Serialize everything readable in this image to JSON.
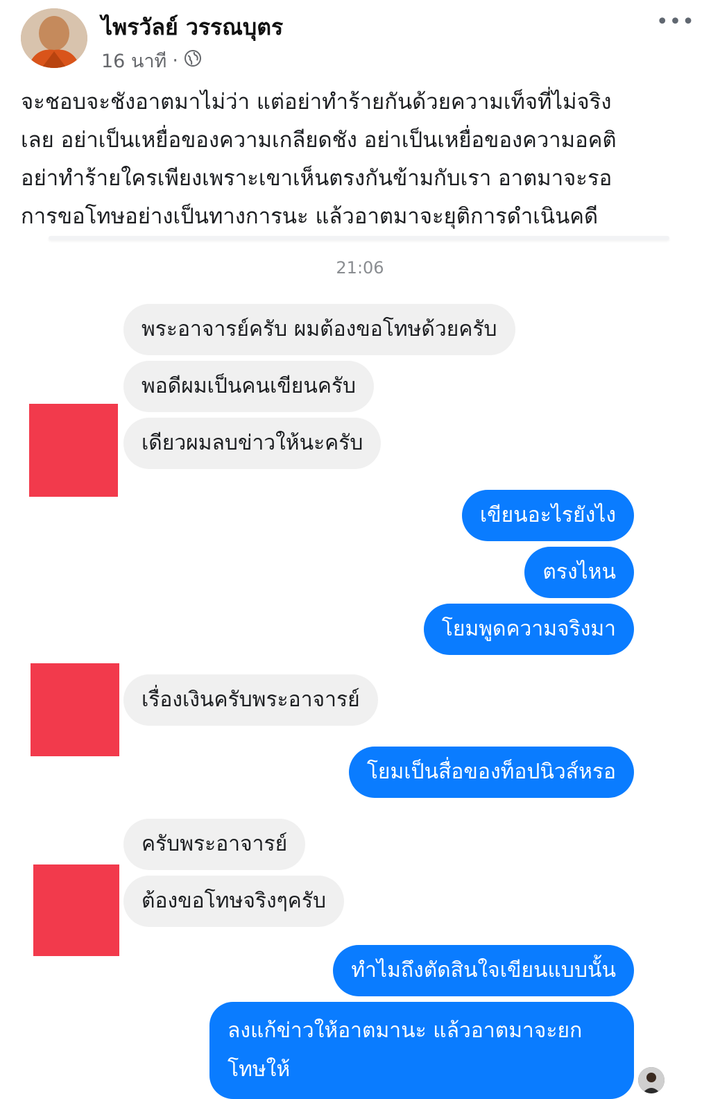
{
  "post": {
    "author_name": "ไพรวัลย์ วรรณบุตร",
    "time": "16 นาที",
    "separator": "·",
    "privacy_icon": "globe-icon",
    "more_icon": "more-options-icon",
    "more_text": "•••",
    "lines": [
      "จะชอบจะชังอาตมาไม่ว่า แต่อย่าทำร้ายกันด้วยความเท็จที่ไม่จริง",
      "เลย อย่าเป็นเหยื่อของความเกลียดชัง อย่าเป็นเหยื่อของความอคติ",
      "อย่าทำร้ายใครเพียงเพราะเขาเห็นตรงกันข้ามกับเรา อาตมาจะรอ",
      "การขอโทษอย่างเป็นทางการนะ แล้วอาตมาจะยุติการดำเนินคดี"
    ]
  },
  "chat": {
    "timestamp": "21:06",
    "messages": [
      {
        "side": "in",
        "text": "พระอาจารย์ครับ ผมต้องขอโทษด้วยครับ"
      },
      {
        "side": "in",
        "text": "พอดีผมเป็นคนเขียนครับ"
      },
      {
        "side": "in",
        "text": "เดียวผมลบข่าวให้นะครับ"
      },
      {
        "side": "out",
        "text": "เขียนอะไรยังไง"
      },
      {
        "side": "out",
        "text": "ตรงไหน"
      },
      {
        "side": "out",
        "text": "โยมพูดความจริงมา"
      },
      {
        "side": "in",
        "text": "เรื่องเงินครับพระอาจารย์"
      },
      {
        "side": "out",
        "text": "โยมเป็นสื่อของท็อปนิวส์หรอ"
      },
      {
        "side": "in",
        "text": "ครับพระอาจารย์"
      },
      {
        "side": "in",
        "text": "ต้องขอโทษจริงๆครับ"
      },
      {
        "side": "out",
        "text": "ทำไมถึงตัดสินใจเขียนแบบนั้น"
      },
      {
        "side": "out",
        "text": "ลงแก้ข่าวให้อาตมานะ แล้วอาตมาจะยกโทษให้"
      }
    ],
    "colors": {
      "incoming_bg": "#f0f0f0",
      "outgoing_bg": "#0a7cff",
      "redaction": "#f23a4c"
    }
  }
}
